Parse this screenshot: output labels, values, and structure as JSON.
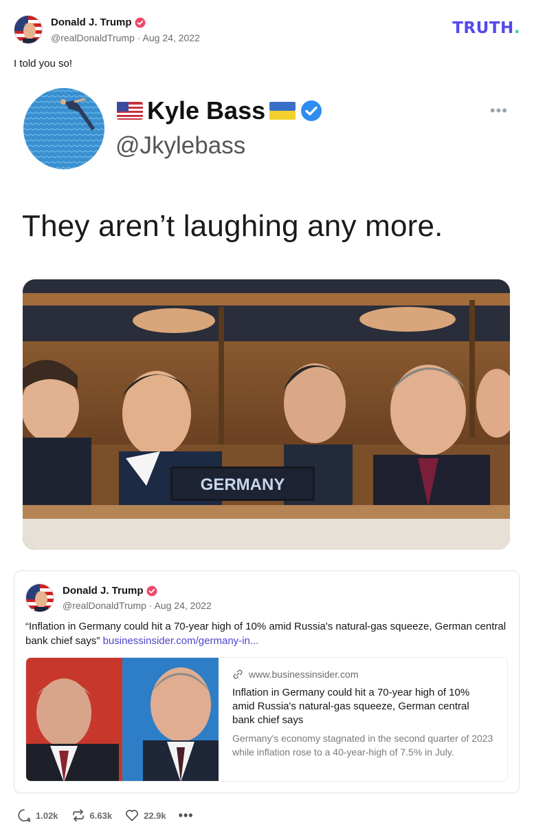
{
  "post": {
    "author": "Donald J. Trump",
    "handle": "@realDonaldTrump",
    "date": "Aug 24, 2022",
    "handle_line": "@realDonaldTrump · Aug 24, 2022",
    "text": "I told you so!"
  },
  "brand": {
    "logo_text": "TRUTH",
    "logo_dot": ".",
    "color": "#5448ee",
    "accent": "#1fd7ab"
  },
  "embedded_tweet": {
    "name": "Kyle Bass",
    "handle": "@Jkylebass",
    "more": "•••",
    "quote": "They aren’t laughing any more.",
    "nameplate": "GERMANY",
    "verified_color": "#2f8cf0"
  },
  "quoted_post": {
    "author": "Donald J. Trump",
    "handle_line": "@realDonaldTrump · Aug 24, 2022",
    "text": "“Inflation in Germany could hit a 70-year high of 10% amid Russia's natural-gas squeeze, German central bank chief says”",
    "link_text": "businessinsider.com/germany-in...",
    "link_card": {
      "domain": "www.businessinsider.com",
      "title": "Inflation in Germany could hit a 70-year high of 10% amid Russia's natural-gas squeeze, German central bank chief says",
      "description": "Germany's economy stagnated in the second quarter of 2023 while inflation rose to a 40-year-high of 7.5% in July."
    }
  },
  "actions": {
    "replies": "1.02k",
    "retruths": "6.63k",
    "likes": "22.9k",
    "more": "•••"
  },
  "icons": [
    "verified-badge-icon",
    "reply-icon",
    "retruth-icon",
    "heart-icon",
    "link-icon",
    "more-icon"
  ]
}
